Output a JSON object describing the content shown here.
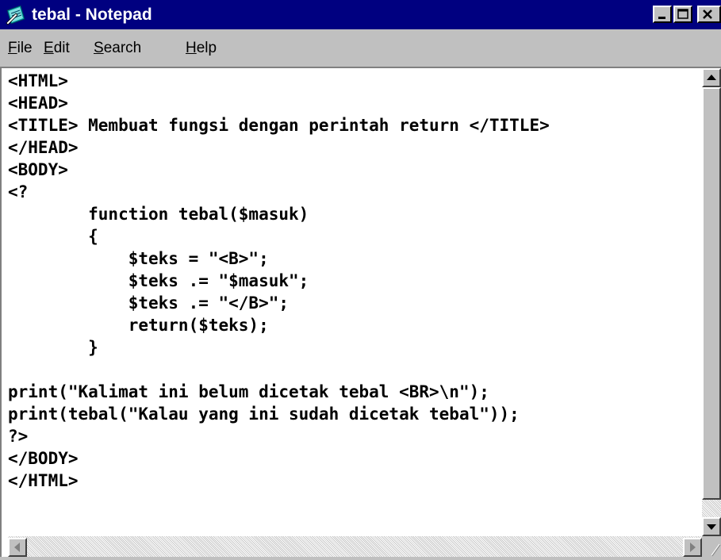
{
  "window": {
    "title": "tebal - Notepad",
    "icon": "notepad-icon",
    "controls": [
      "minimize-icon",
      "maximize-icon",
      "close-icon"
    ]
  },
  "menu": [
    {
      "label": "File",
      "mnemonic": "F",
      "rest": "ile"
    },
    {
      "label": "Edit",
      "mnemonic": "E",
      "rest": "dit"
    },
    {
      "label": "Search",
      "mnemonic": "S",
      "rest": "earch"
    },
    {
      "label": "Help",
      "mnemonic": "H",
      "rest": "elp"
    }
  ],
  "editor": {
    "lines": [
      "<HTML>",
      "<HEAD>",
      "<TITLE> Membuat fungsi dengan perintah return </TITLE>",
      "</HEAD>",
      "<BODY>",
      "<?",
      "        function tebal($masuk)",
      "        {",
      "            $teks = \"<B>\";",
      "            $teks .= \"$masuk\";",
      "            $teks .= \"</B>\";",
      "            return($teks);",
      "        }",
      "",
      "print(\"Kalimat ini belum dicetak tebal <BR>\\n\");",
      "print(tebal(\"Kalau yang ini sudah dicetak tebal\"));",
      "?>",
      "</BODY>",
      "</HTML>"
    ]
  },
  "scrollbars": {
    "vertical": {
      "up": "up-arrow-icon",
      "down": "down-arrow-icon"
    },
    "horizontal": {
      "left": "left-arrow-icon",
      "right": "right-arrow-icon"
    }
  }
}
